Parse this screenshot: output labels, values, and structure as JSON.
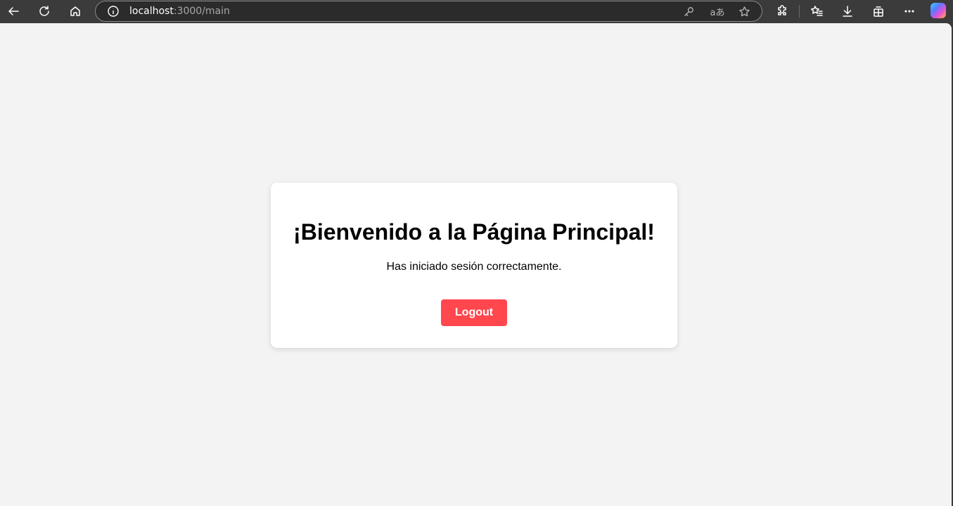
{
  "browser": {
    "url_host": "localhost",
    "url_path": ":3000/main",
    "translate_label": "aあ"
  },
  "page": {
    "heading": "¡Bienvenido a la Página Principal!",
    "message": "Has iniciado sesión correctamente.",
    "logout_label": "Logout"
  },
  "colors": {
    "page_background": "#f3f3f3",
    "card_background": "#ffffff",
    "logout_button": "#ff474d",
    "browser_chrome": "#3b3b3b"
  },
  "icons": [
    "back-arrow-icon",
    "refresh-icon",
    "home-icon",
    "info-icon",
    "key-icon",
    "translate-icon",
    "favorite-star-icon",
    "extensions-icon",
    "favorites-list-icon",
    "download-icon",
    "collections-icon",
    "more-options-icon",
    "copilot-icon"
  ]
}
